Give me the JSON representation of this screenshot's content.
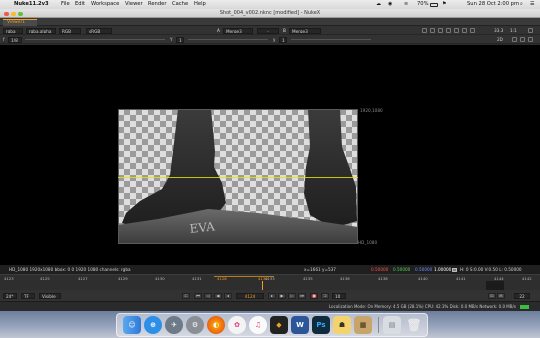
{
  "menubar": {
    "app": "Nuke11.2v3",
    "items": [
      "File",
      "Edit",
      "Workspace",
      "Viewer",
      "Render",
      "Cache",
      "Help"
    ],
    "battery": "70%",
    "datetime": "Sun 28 Oct  2:00 pm"
  },
  "window": {
    "title": "Shot_004_v002.nknc [modified] - NukeX"
  },
  "tabs": [
    {
      "label": "Viewer1"
    }
  ],
  "toolbar1": {
    "channels": "rgba",
    "layer": "rgba.alpha",
    "colorspace": "RGB",
    "lut": "sRGB",
    "input_a_letter": "A",
    "input_a": "Merge3",
    "wipe": "-",
    "input_b_letter": "B",
    "input_b": "Merge3",
    "zoom": "33.3",
    "ratio": "1:1"
  },
  "toolbar2": {
    "f_label": "f",
    "f_stop": "1/8",
    "y_label": "Y",
    "y_value": "1",
    "gamma_label": "y",
    "gamma_value": "1",
    "proxy": "2D"
  },
  "viewer": {
    "format_top_right": "1920,1080",
    "format_bottom_right": "HD_1080",
    "wall_text": "EVA"
  },
  "infobar": {
    "left": "HD_1080 1920x1080  bbox: 0 0 1920 1080 channels: rgba",
    "coords": "x=1661 y=537",
    "r": "0.50000",
    "g": "0.50000",
    "b": "0.50000",
    "a": "1.00000",
    "hsv": "H: 0 S:0.00 V:0.50  L: 0.50000"
  },
  "timeline": {
    "labels": [
      "4123",
      "4125",
      "4127",
      "4129",
      "4130",
      "4131",
      "4133",
      "4135",
      "4136",
      "4138",
      "4140",
      "4141",
      "4144",
      "4142"
    ],
    "in_marker": "4128",
    "current": "4130"
  },
  "controls": {
    "fps": "24*",
    "tf": "TF",
    "visibility": "Visible",
    "frame": "4124",
    "increment": "10",
    "end_field": "22"
  },
  "statusbar": {
    "text": "Localization Mode: On  Memory: 4.5 GB (28.1%)  CPU: 42.3%  Disk: 0.0 MB/s  Network: 0.0 MB/s"
  },
  "dock": {
    "icons": [
      "finder-icon",
      "safari-icon",
      "launchpad-icon",
      "system-prefs-icon",
      "firefox-icon",
      "photos-icon",
      "itunes-icon",
      "nuke-icon",
      "word-icon",
      "photoshop-icon",
      "migration-icon",
      "app-icon",
      "trash-icon"
    ]
  },
  "colors": {
    "accent_orange": "#f0a020",
    "crosshair_yellow": "#e6e000"
  }
}
